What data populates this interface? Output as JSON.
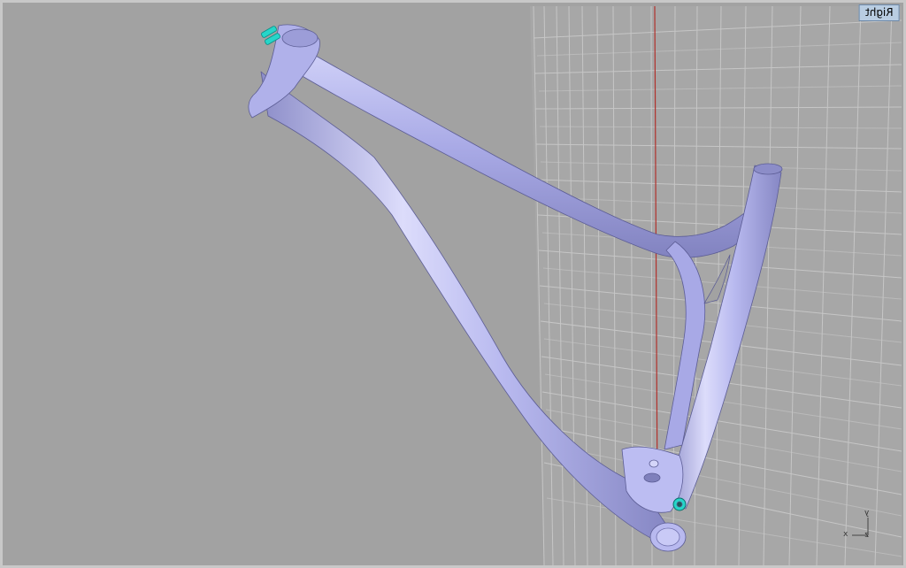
{
  "viewport": {
    "name": "Right",
    "background": "#a2a2a2",
    "grid_color": "#c3c3c3",
    "axis_line_color": "#b2312c",
    "model_color": "#b4b5ee",
    "highlight_color": "#26d6c9"
  },
  "axis_widget": {
    "vertical_axis": "y",
    "horizontal_axis": "x",
    "depth_axis": "z"
  }
}
